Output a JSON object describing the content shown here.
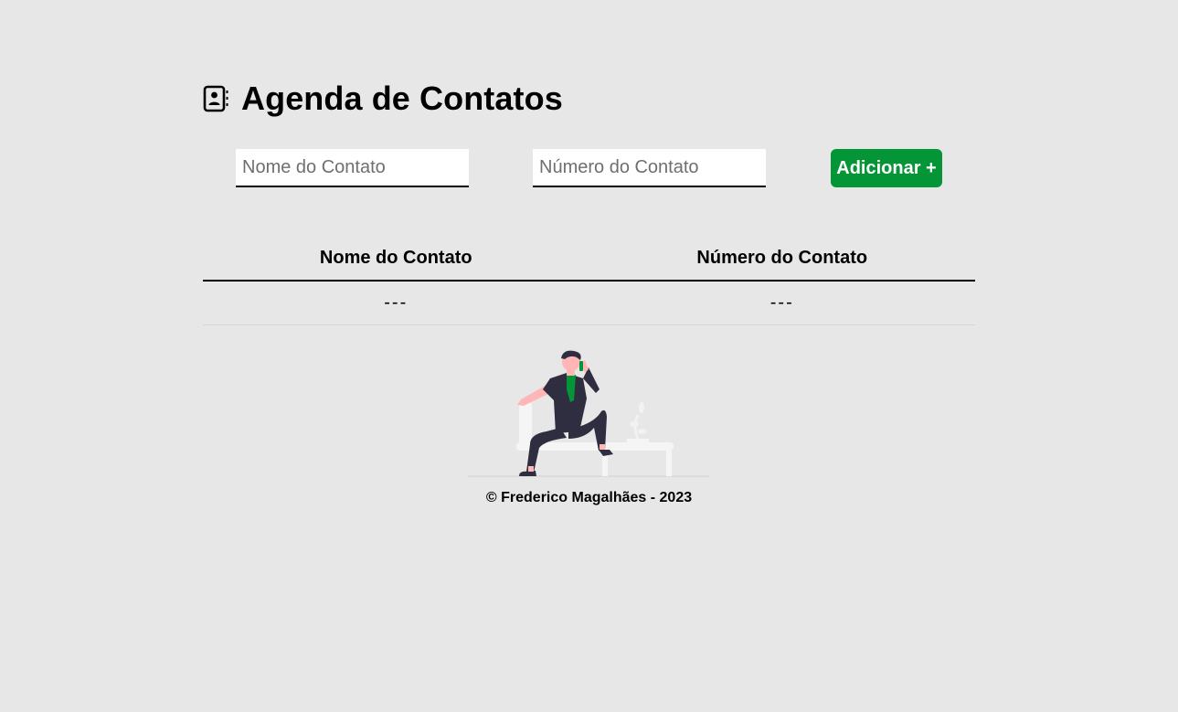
{
  "header": {
    "title": "Agenda de Contatos",
    "icon": "contact-book-icon"
  },
  "form": {
    "name_placeholder": "Nome do Contato",
    "name_value": "",
    "number_placeholder": "Número do Contato",
    "number_value": "",
    "add_button_label": "Adicionar +"
  },
  "table": {
    "headers": [
      "Nome do Contato",
      "Número do Contato"
    ],
    "rows": [
      [
        "---",
        "---"
      ]
    ]
  },
  "footer": {
    "text": "© Frederico Magalhães - 2023"
  },
  "colors": {
    "background": "#e7e7e7",
    "accent": "#049536",
    "text": "#000000"
  }
}
